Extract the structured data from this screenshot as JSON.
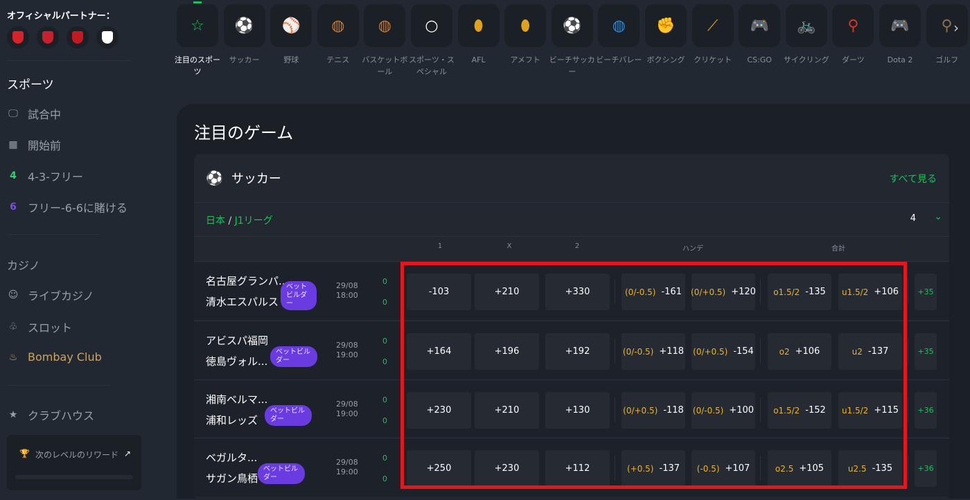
{
  "sidebar": {
    "partners_title": "オフィシャルパートナー：",
    "partners": [
      {
        "name": "arsenal",
        "color": "#d6232a"
      },
      {
        "name": "southampton",
        "color": "#c8202f"
      },
      {
        "name": "flamengo",
        "color": "#c21a20"
      },
      {
        "name": "sao-paulo",
        "color": "#ffffff"
      }
    ],
    "sports_heading": "スポーツ",
    "sports_items": [
      {
        "icon": "monitor-icon",
        "glyph": "🖵",
        "label": "試合中"
      },
      {
        "icon": "calendar-icon",
        "glyph": "▦",
        "label": "開始前"
      },
      {
        "icon": "four-badge-icon",
        "glyph": "4",
        "label": "4-3-フリー",
        "color": "#2fd36a"
      },
      {
        "icon": "six-badge-icon",
        "glyph": "6",
        "label": "フリー-6-6に賭ける",
        "color": "#7a4ee8"
      }
    ],
    "casino_heading": "カジノ",
    "casino_items": [
      {
        "icon": "live-casino-icon",
        "glyph": "☺",
        "label": "ライブカジノ"
      },
      {
        "icon": "slot-icon",
        "glyph": "♧",
        "label": "スロット"
      },
      {
        "icon": "bombay-club-icon",
        "glyph": "♨",
        "label": "Bombay Club",
        "color": "#c9a46a"
      }
    ],
    "clubhouse": "クラブハウス",
    "reward": "次のレベルのリワード"
  },
  "sports_nav": [
    {
      "label": "注目のスポーツ",
      "glyph": "☆",
      "color": "#1fbf5f",
      "active": true
    },
    {
      "label": "サッカー",
      "glyph": "⚽",
      "color": "#d9342b"
    },
    {
      "label": "野球",
      "glyph": "⚾",
      "color": "#6b5a52"
    },
    {
      "label": "テニス",
      "glyph": "◍",
      "color": "#c77b3a"
    },
    {
      "label": "バスケットボール",
      "glyph": "◍",
      "color": "#c77b3a"
    },
    {
      "label": "スポーツ・スペシャル",
      "glyph": "○",
      "color": "#ffffff"
    },
    {
      "label": "AFL",
      "glyph": "⬮",
      "color": "#e0a21c"
    },
    {
      "label": "アメフト",
      "glyph": "⬮",
      "color": "#e0a21c"
    },
    {
      "label": "ビーチサッカー",
      "glyph": "⚽",
      "color": "#d9342b"
    },
    {
      "label": "ビーチバレー",
      "glyph": "◍",
      "color": "#2a8ad8"
    },
    {
      "label": "ボクシング",
      "glyph": "✊",
      "color": "#d9342b"
    },
    {
      "label": "クリケット",
      "glyph": "⟋",
      "color": "#e0a21c"
    },
    {
      "label": "CS:GO",
      "glyph": "🎮",
      "color": "#6a4be8"
    },
    {
      "label": "サイクリング",
      "glyph": "🚲",
      "color": "#f0b323"
    },
    {
      "label": "ダーツ",
      "glyph": "⚲",
      "color": "#d9342b"
    },
    {
      "label": "Dota 2",
      "glyph": "🎮",
      "color": "#6a4be8"
    },
    {
      "label": "ゴルフ",
      "glyph": "⚲",
      "color": "#8a7050"
    }
  ],
  "main": {
    "title": "注目のゲーム",
    "sport": "サッカー",
    "see_all": "すべて見る",
    "country": "日本",
    "league": "J1リーグ",
    "match_count": "4",
    "columns": [
      "1",
      "X",
      "2",
      "ハンデ",
      "合計"
    ],
    "matches": [
      {
        "home": "名古屋グランパ...",
        "away": "清水エスパルス",
        "badge": "ベットビルダー",
        "date": "29/08",
        "time": "18:00",
        "score_home": "0",
        "score_away": "0",
        "odds": [
          "-103",
          "+210",
          "+330"
        ],
        "handicap": [
          [
            "(0/-0.5)",
            "-161"
          ],
          [
            "(0/+0.5)",
            "+120"
          ]
        ],
        "total": [
          [
            "o1.5/2",
            "-135"
          ],
          [
            "u1.5/2",
            "+106"
          ]
        ],
        "more": "+35"
      },
      {
        "home": "アビスパ福岡",
        "away": "徳島ヴォル...",
        "badge": "ベットビルダー",
        "date": "29/08",
        "time": "19:00",
        "score_home": "0",
        "score_away": "0",
        "odds": [
          "+164",
          "+196",
          "+192"
        ],
        "handicap": [
          [
            "(0/-0.5)",
            "+118"
          ],
          [
            "(0/+0.5)",
            "-154"
          ]
        ],
        "total": [
          [
            "o2",
            "+106"
          ],
          [
            "u2",
            "-137"
          ]
        ],
        "more": "+35"
      },
      {
        "home": "湘南ベルマ...",
        "away": "浦和レッズ",
        "badge": "ベットビルダー",
        "date": "29/08",
        "time": "19:00",
        "score_home": "0",
        "score_away": "0",
        "odds": [
          "+230",
          "+210",
          "+130"
        ],
        "handicap": [
          [
            "(0/+0.5)",
            "-118"
          ],
          [
            "(0/-0.5)",
            "+100"
          ]
        ],
        "total": [
          [
            "o1.5/2",
            "-152"
          ],
          [
            "u1.5/2",
            "+115"
          ]
        ],
        "more": "+36"
      },
      {
        "home": "ベガルタ...",
        "away": "サガン鳥栖",
        "badge": "ベットビルダー",
        "date": "29/08",
        "time": "19:00",
        "score_home": "0",
        "score_away": "0",
        "odds": [
          "+250",
          "+230",
          "+112"
        ],
        "handicap": [
          [
            "(+0.5)",
            "-137"
          ],
          [
            "(-0.5)",
            "+107"
          ]
        ],
        "total": [
          [
            "o2.5",
            "+105"
          ],
          [
            "u2.5",
            "-135"
          ]
        ],
        "more": "+36"
      }
    ]
  },
  "colors": {
    "accent": "#1fbf5f",
    "highlight_box": "#e8141e",
    "badge": "#6a3be0",
    "handicap_label": "#f0b323"
  }
}
